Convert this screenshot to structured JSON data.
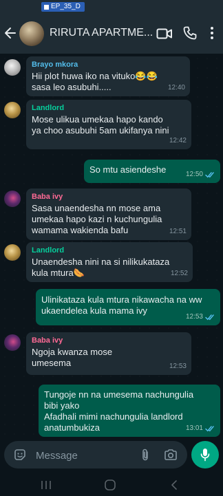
{
  "status_bar": {
    "tag": "EP_35_D"
  },
  "header": {
    "title": "RIRUTA APARTME..."
  },
  "messages": [
    {
      "sender": "Brayo mkora",
      "text": "Hii plot huwa iko na  vituko😂😂\nsasa leo asubuhi.....",
      "time": "12:40"
    },
    {
      "sender": "Landlord",
      "text": "Mose ulikua umekaa hapo kando\nya choo asubuhi 5am ukifanya nini",
      "time": "12:42"
    },
    {
      "text": "So mtu asiendeshe",
      "time": "12:50"
    },
    {
      "sender": "Baba ivy",
      "text": "Sasa unaendesha nn mose  ama\numekaa hapo kazi n kuchungulia\nwamama wakienda bafu",
      "time": "12:51"
    },
    {
      "sender": "Landlord",
      "text": "Unaendesha nini na  si nilikukataza\nkula mtura🌭",
      "time": "12:52"
    },
    {
      "text": "Ulinikataza kula mtura nikawacha na ww\nukaendelea kula mama ivy",
      "time": "12:53"
    },
    {
      "sender": "Baba ivy",
      "text": "Ngoja kwanza mose\numesema",
      "time": "12:53"
    },
    {
      "text": "Tungoje nn na umesema nachungulia\nbibi yako\nAfadhali mimi nachungulia landlord\nanatumbukiza",
      "time": "13:01"
    }
  ],
  "composer": {
    "placeholder": "Message"
  },
  "colors": {
    "incoming": "#1f2c34",
    "outgoing": "#005c4b",
    "accent": "#00a884",
    "read_ticks": "#53bdeb"
  }
}
